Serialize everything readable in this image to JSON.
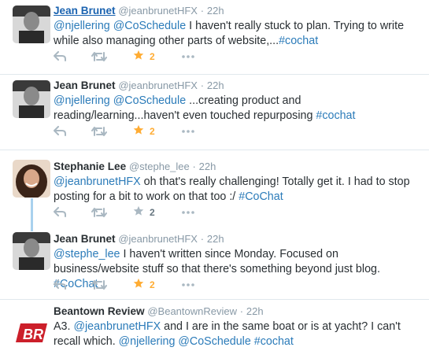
{
  "tweets": [
    {
      "name": "Jean Brunet",
      "handle": "@jeanbrunetHFX",
      "dot": "·",
      "time": "22h",
      "mentions": [
        "@njellering",
        "@CoSchedule"
      ],
      "text": "I haven't really stuck to plan. Trying to write while also managing other parts of website,...",
      "hashtag": "#cochat",
      "favorite_count": "2",
      "favorited": true
    },
    {
      "name": "Jean Brunet",
      "handle": "@jeanbrunetHFX",
      "dot": "·",
      "time": "22h",
      "mentions": [
        "@njellering",
        "@CoSchedule"
      ],
      "text": "...creating product and reading/learning...haven't even touched repurposing",
      "hashtag": "#cochat",
      "favorite_count": "2",
      "favorited": true
    },
    {
      "name": "Stephanie Lee",
      "handle": "@stephe_lee",
      "dot": "·",
      "time": "22h",
      "mentions": [
        "@jeanbrunetHFX"
      ],
      "text": "oh that's really challenging! Totally get it. I had to stop posting for a bit to work on that too :/",
      "hashtag": "#CoChat",
      "favorite_count": "2",
      "favorited": false
    },
    {
      "name": "Jean Brunet",
      "handle": "@jeanbrunetHFX",
      "dot": "·",
      "time": "22h",
      "mentions": [
        "@stephe_lee"
      ],
      "text": "I haven't written since Monday. Focused on business/website stuff so that there's something beyond just blog.",
      "hashtag": "#CoChat",
      "favorite_count": "2",
      "favorited": true
    },
    {
      "name": "Beantown Review",
      "handle": "@BeantownReview",
      "dot": "·",
      "time": "22h",
      "prefix": "A3.",
      "mentions": [
        "@jeanbrunetHFX"
      ],
      "text": "and I are in the same boat or is at yacht? I can't recall which.",
      "mentions2": [
        "@njellering",
        "@CoSchedule"
      ],
      "hashtag": "#cochat",
      "logo": "BR"
    }
  ],
  "colors": {
    "link": "#2b7bb9",
    "star_active": "#ffac33",
    "icon_gray": "#aab8c2",
    "thread_line": "#a9d1ee"
  },
  "icons": [
    "reply-icon",
    "retweet-icon",
    "star-icon",
    "more-icon"
  ]
}
